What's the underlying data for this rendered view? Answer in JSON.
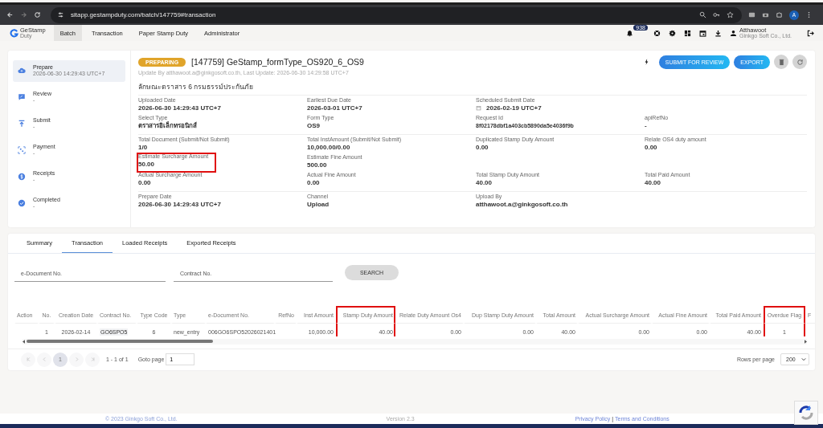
{
  "browser": {
    "url": "sitapp.gestampduty.com/batch/147759#transaction",
    "profile": "A"
  },
  "header": {
    "logo": {
      "name": "GeStamp",
      "sub": "Duty"
    },
    "nav": [
      {
        "label": "Batch",
        "selected": true
      },
      {
        "label": "Transaction",
        "selected": false
      },
      {
        "label": "Paper Stamp Duty",
        "selected": false
      },
      {
        "label": "Administrator",
        "selected": false
      }
    ],
    "notification_count": "938",
    "user": {
      "name": "Atthawoot",
      "company": "Ginkgo Soft Co., Ltd."
    }
  },
  "steps": [
    {
      "label": "Prepare",
      "detail": "2026-06-30 14:29:43 UTC+7",
      "selected": true
    },
    {
      "label": "Review",
      "detail": "-",
      "selected": false
    },
    {
      "label": "Submit",
      "detail": "-",
      "selected": false
    },
    {
      "label": "Payment",
      "detail": "-",
      "selected": false
    },
    {
      "label": "Receipts",
      "detail": "-",
      "selected": false
    },
    {
      "label": "Completed",
      "detail": "-",
      "selected": false
    }
  ],
  "batch": {
    "status": "PREPARING",
    "title": "[147759] GeStamp_formType_OS920_6_OS9",
    "subtitle": "Update By atthawoot.a@ginkgosoft.co.th, Last Update: 2026-06-30 14:29:58 UTC+7",
    "heading": "ลักษณะตราสาร 6 กรมธรรม์ประกันภัย",
    "actions": [
      {
        "label": "SUBMIT FOR REVIEW"
      },
      {
        "label": "EXPORT"
      }
    ],
    "sections": [
      [
        [
          {
            "label": "Uploaded Date",
            "value": "2026-06-30 14:29:43 UTC+7",
            "kind": "text",
            "highlighted": false
          },
          {
            "label": "Earliest Due Date",
            "value": "2026-03-01 UTC+7",
            "kind": "text",
            "highlighted": false
          },
          {
            "label": "Scheduled Submit Date",
            "value": "2026-02-19 UTC+7",
            "kind": "date",
            "highlighted": false
          }
        ],
        [
          {
            "label": "Select Type",
            "value": "ตราสารอิเล็กทรอนิกส์",
            "kind": "text",
            "highlighted": false
          },
          {
            "label": "Form Type",
            "value": "OS9",
            "kind": "text",
            "highlighted": false
          },
          {
            "label": "Request Id",
            "value": "8f02178dbf1a403cb5890da5e4036f9b",
            "kind": "small",
            "highlighted": false
          },
          {
            "label": "apiRefNo",
            "value": "-",
            "kind": "text",
            "highlighted": false
          }
        ]
      ],
      [
        [
          {
            "label": "Total Document (Submit/Not Submit)",
            "value": "1/0",
            "kind": "text",
            "highlighted": false
          },
          {
            "label": "Total InstAmount (Submit/Not Submit)",
            "value": "10,000.00/0.00",
            "kind": "text",
            "highlighted": false
          },
          {
            "label": "Duplicated Stamp Duty Amount",
            "value": "0.00",
            "kind": "text",
            "highlighted": false
          },
          {
            "label": "Relate OS4 duty amount",
            "value": "0.00",
            "kind": "text",
            "highlighted": false
          }
        ],
        [
          {
            "label": "Estimate Surcharge Amount",
            "value": "50.00",
            "kind": "text",
            "highlighted": true
          },
          {
            "label": "Estimate Fine Amount",
            "value": "500.00",
            "kind": "text",
            "highlighted": false
          }
        ],
        [
          {
            "label": "Actual Surcharge Amount",
            "value": "0.00",
            "kind": "text",
            "highlighted": false
          },
          {
            "label": "Actual Fine Amount",
            "value": "0.00",
            "kind": "text",
            "highlighted": false
          },
          {
            "label": "Total Stamp Duty Amount",
            "value": "40.00",
            "kind": "text",
            "highlighted": false
          },
          {
            "label": "Total Paid Amount",
            "value": "40.00",
            "kind": "text",
            "highlighted": false
          }
        ]
      ],
      [
        [
          {
            "label": "Prepare Date",
            "value": "2026-06-30 14:29:43 UTC+7",
            "kind": "text",
            "highlighted": false
          },
          {
            "label": "Channel",
            "value": "Upload",
            "kind": "text",
            "highlighted": false
          },
          {
            "label": "Upload By",
            "value": "atthawoot.a@ginkgosoft.co.th",
            "kind": "text",
            "highlighted": false
          }
        ]
      ]
    ]
  },
  "tabs": [
    {
      "label": "Summary",
      "selected": false
    },
    {
      "label": "Transaction",
      "selected": true
    },
    {
      "label": "Loaded Receipts",
      "selected": false
    },
    {
      "label": "Exported Receipts",
      "selected": false
    }
  ],
  "filters": [
    {
      "placeholder": "e-Document No."
    },
    {
      "placeholder": "Contract No."
    }
  ],
  "search_button": "SEARCH",
  "table": {
    "columns": [
      {
        "label": "Action",
        "highlighted": false
      },
      {
        "label": "No.",
        "highlighted": false
      },
      {
        "label": "Creation Date",
        "highlighted": false
      },
      {
        "label": "Contract No.",
        "highlighted": false
      },
      {
        "label": "Type Code",
        "highlighted": false
      },
      {
        "label": "Type",
        "highlighted": false
      },
      {
        "label": "e-Document No.",
        "highlighted": false
      },
      {
        "label": "RefNo",
        "highlighted": false
      },
      {
        "label": "Inst Amount",
        "highlighted": false
      },
      {
        "label": "Stamp Duty Amount",
        "highlighted": true
      },
      {
        "label": "Relate Duty Amount Os4",
        "highlighted": false
      },
      {
        "label": "Dup Stamp Duty Amount",
        "highlighted": false
      },
      {
        "label": "Total Amount",
        "highlighted": false
      },
      {
        "label": "Actual Surcharge Amount",
        "highlighted": false
      },
      {
        "label": "Actual Fine Amount",
        "highlighted": false
      },
      {
        "label": "Total Paid Amount",
        "highlighted": false
      },
      {
        "label": "Overdue Flag",
        "highlighted": true
      },
      {
        "label": "F",
        "highlighted": false
      }
    ],
    "rows": [
      [
        "",
        "1",
        "2026-02-14",
        "GO6SPO5",
        "6",
        "new_entry",
        "006GO6SPO52026021401",
        "",
        "10,000.00",
        "40.00",
        "0.00",
        "0.00",
        "40.00",
        "0.00",
        "0.00",
        "40.00",
        "1",
        ""
      ]
    ]
  },
  "pagination": {
    "pages": [
      {
        "label": "1",
        "selected": true
      }
    ],
    "range": "1 - 1 of 1",
    "goto_label": "Goto page",
    "goto_value": "1",
    "rows_label": "Rows per page",
    "rows_value": "200"
  },
  "footer": {
    "copyright": "© 2023 Ginkgo Soft Co., Ltd.",
    "version": "Version 2.3",
    "links": [
      "Privacy Policy",
      "Terms and Conditions"
    ],
    "separator": "|"
  }
}
